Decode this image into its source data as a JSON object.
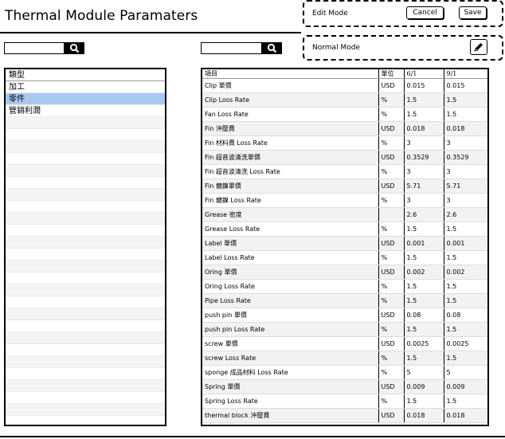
{
  "header": {
    "title": "Thermal Module Paramaters"
  },
  "edit_mode": {
    "label": "Edit Mode",
    "cancel_label": "Cancel",
    "save_label": "Save"
  },
  "normal_mode": {
    "label": "Normal Mode"
  },
  "search_left": {
    "value": "",
    "icon": "search-icon"
  },
  "search_right": {
    "value": "",
    "icon": "search-icon"
  },
  "categories": {
    "header": "類型",
    "items": [
      {
        "label": "加工",
        "selected": false
      },
      {
        "label": "零件",
        "selected": true
      },
      {
        "label": "管銷利潤",
        "selected": false
      }
    ]
  },
  "params": {
    "columns": [
      "項目",
      "單位",
      "6/1",
      "9/1"
    ],
    "rows": [
      [
        "Clip 單價",
        "USD",
        "0.015",
        "0.015"
      ],
      [
        "Clip Loss Rate",
        "%",
        "1.5",
        "1.5"
      ],
      [
        "Fan Loss Rate",
        "%",
        "1.5",
        "1.5"
      ],
      [
        "Fin 沖壓費",
        "USD",
        "0.018",
        "0.018"
      ],
      [
        "Fin 材料費 Loss Rate",
        "%",
        "3",
        "3"
      ],
      [
        "Fin 超音波清洗單價",
        "USD",
        "0.3529",
        "0.3529"
      ],
      [
        "Fin 超音波清洗 Loss Rate",
        "%",
        "3",
        "3"
      ],
      [
        "Fin 鍍鎳單價",
        "USD",
        "5.71",
        "5.71"
      ],
      [
        "Fin 鍍鎳 Loss Rate",
        "%",
        "3",
        "3"
      ],
      [
        "Grease 密度",
        "",
        "2.6",
        "2.6"
      ],
      [
        "Grease Loss Rate",
        "%",
        "1.5",
        "1.5"
      ],
      [
        "Label 單價",
        "USD",
        "0.001",
        "0.001"
      ],
      [
        "Label Loss Rate",
        "%",
        "1.5",
        "1.5"
      ],
      [
        "Oring 單價",
        "USD",
        "0.002",
        "0.002"
      ],
      [
        "Oring Loss Rate",
        "%",
        "1.5",
        "1.5"
      ],
      [
        "Pipe Loss Rate",
        "%",
        "1.5",
        "1.5"
      ],
      [
        "push pin 單價",
        "USD",
        "0.08",
        "0.08"
      ],
      [
        "push pin Loss Rate",
        "%",
        "1.5",
        "1.5"
      ],
      [
        "screw 單價",
        "USD",
        "0.0025",
        "0.0025"
      ],
      [
        "screw Loss Rate",
        "%",
        "1.5",
        "1.5"
      ],
      [
        "sponge 成品材料 Loss Rate",
        "%",
        "5",
        "5"
      ],
      [
        "Spring 單價",
        "USD",
        "0.009",
        "0.009"
      ],
      [
        "Spring Loss Rate",
        "%",
        "1.5",
        "1.5"
      ],
      [
        "thermal block 沖壓費",
        "USD",
        "0.018",
        "0.018"
      ]
    ]
  }
}
